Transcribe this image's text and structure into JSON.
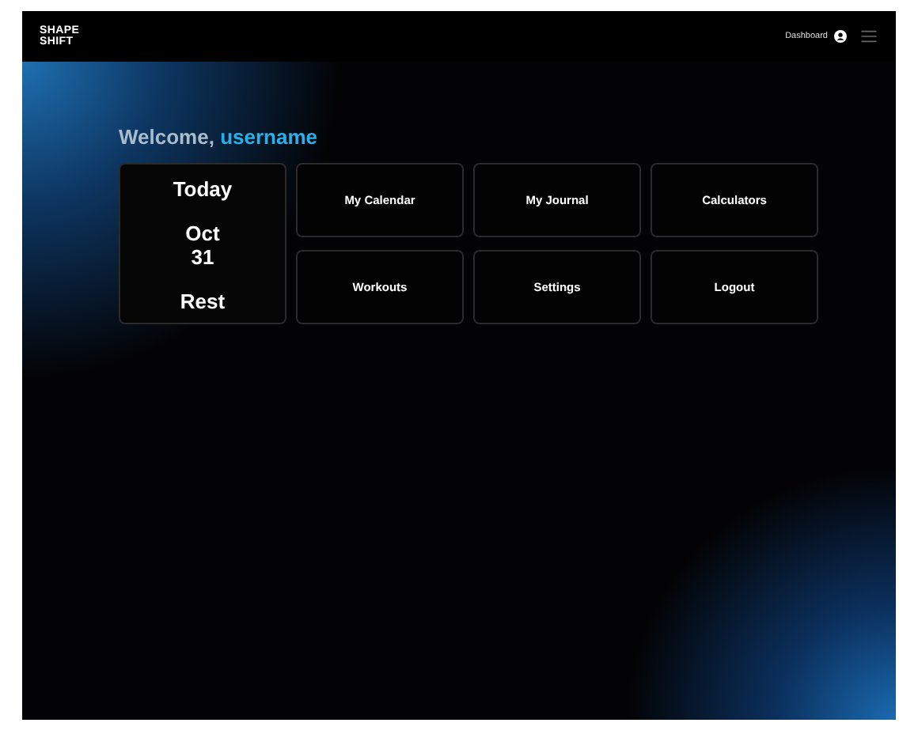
{
  "header": {
    "logo": "SHAPE SHIFT",
    "nav_link": "Dashboard"
  },
  "welcome": {
    "greeting": "Welcome,",
    "username": "username"
  },
  "today": {
    "label": "Today",
    "month": "Oct",
    "day": "31",
    "activity": "Rest"
  },
  "tiles": [
    {
      "label": "My Calendar"
    },
    {
      "label": "My Journal"
    },
    {
      "label": "Calculators"
    },
    {
      "label": "Workouts"
    },
    {
      "label": "Settings"
    },
    {
      "label": "Logout"
    }
  ]
}
